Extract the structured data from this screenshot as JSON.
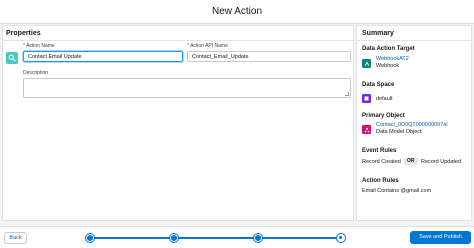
{
  "header": {
    "title": "New Action"
  },
  "properties": {
    "title": "Properties",
    "action_name_label": "Action Name",
    "action_name_value": "Contact Email Update",
    "api_name_label": "Action API Name",
    "api_name_value": "Contact_Email_Update",
    "description_label": "Description",
    "description_value": "",
    "required_mark": "*"
  },
  "summary": {
    "title": "Summary",
    "target": {
      "heading": "Data Action Target",
      "link": "WebhookAT2",
      "type": "Webhook",
      "icon": "webhook-icon",
      "icon_color": "#0b827c"
    },
    "data_space": {
      "heading": "Data Space",
      "value": "default",
      "icon": "data-space-icon",
      "icon_color": "#7526e3"
    },
    "primary_object": {
      "heading": "Primary Object",
      "link": "Contact_0D0QT000000097al",
      "type": "Data Model Object",
      "icon": "data-model-icon",
      "icon_color": "#e3066a"
    },
    "event_rules": {
      "heading": "Event Rules",
      "left": "Record Created",
      "op": "OR",
      "right": "Record Updated"
    },
    "action_rules": {
      "heading": "Action Rules",
      "value": "Email Contains @gmail.com"
    }
  },
  "footer": {
    "back_label": "Back",
    "save_label": "Save and Publish",
    "steps": 4,
    "current_step": 4
  },
  "colors": {
    "brand": "#0176d3",
    "link": "#0b5cab",
    "side_icon": "#4bc6c0"
  }
}
